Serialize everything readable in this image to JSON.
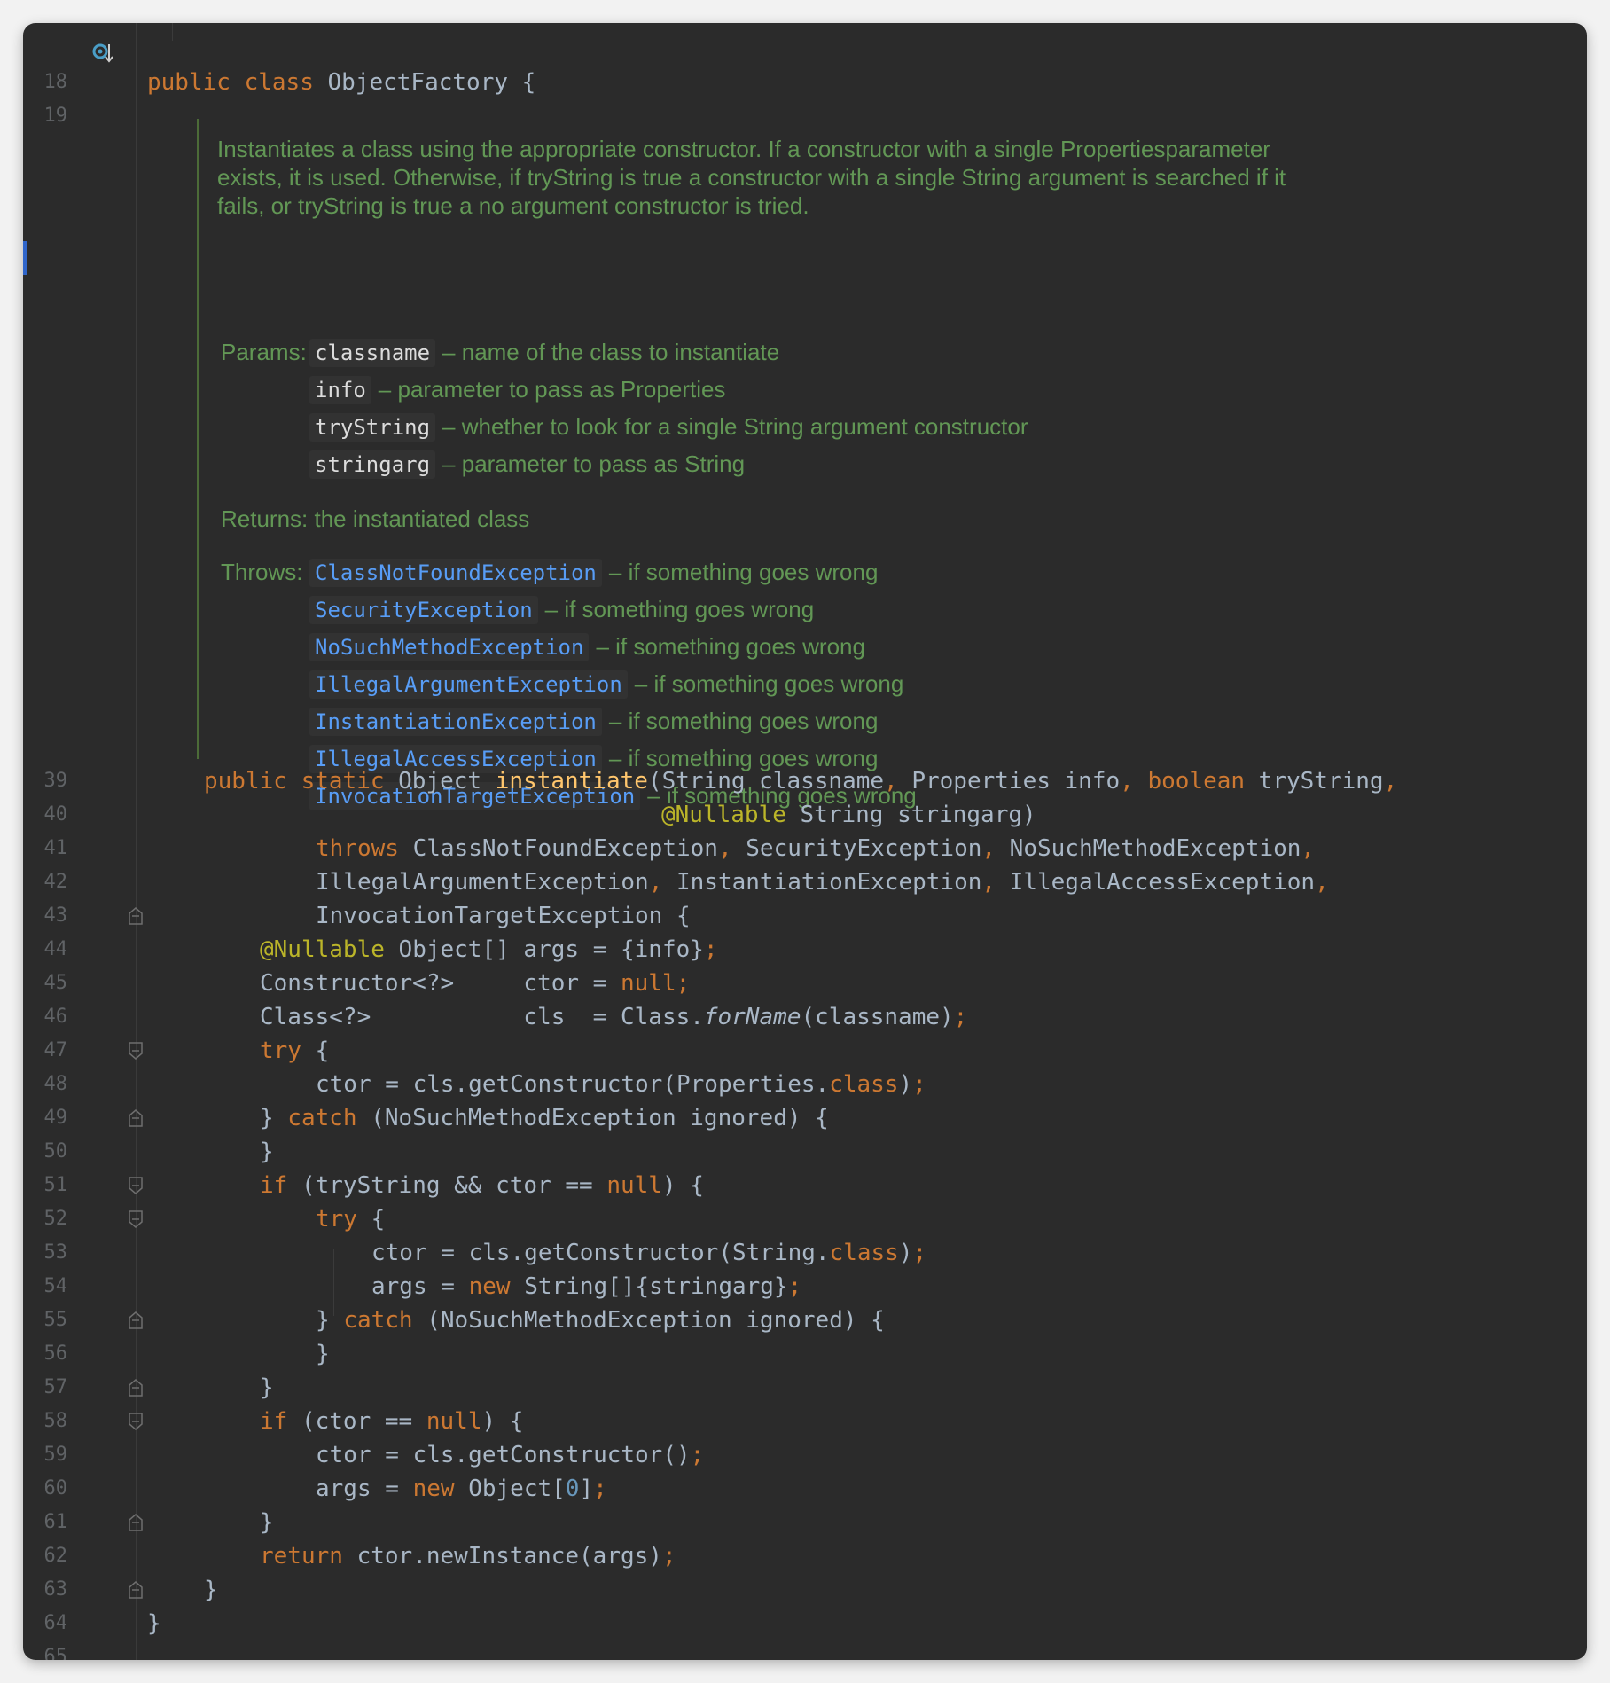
{
  "editor": {
    "lines": [
      {
        "num": "18",
        "text": "public class ObjectFactory {"
      },
      {
        "num": "19",
        "text": ""
      },
      {
        "num": "39",
        "text": "public static Object instantiate(String classname, Properties info, boolean tryString,"
      },
      {
        "num": "40",
        "text": "@Nullable String stringarg)"
      },
      {
        "num": "41",
        "text": "throws ClassNotFoundException, SecurityException, NoSuchMethodException,"
      },
      {
        "num": "42",
        "text": "IllegalArgumentException, InstantiationException, IllegalAccessException,"
      },
      {
        "num": "43",
        "text": "InvocationTargetException {"
      },
      {
        "num": "44",
        "text": "@Nullable Object[] args = {info};"
      },
      {
        "num": "45",
        "text": "Constructor<?>     ctor = null;"
      },
      {
        "num": "46",
        "text": "Class<?>           cls  = Class.forName(classname);"
      },
      {
        "num": "47",
        "text": "try {"
      },
      {
        "num": "48",
        "text": "ctor = cls.getConstructor(Properties.class);"
      },
      {
        "num": "49",
        "text": "} catch (NoSuchMethodException ignored) {"
      },
      {
        "num": "50",
        "text": "}"
      },
      {
        "num": "51",
        "text": "if (tryString && ctor == null) {"
      },
      {
        "num": "52",
        "text": "try {"
      },
      {
        "num": "53",
        "text": "ctor = cls.getConstructor(String.class);"
      },
      {
        "num": "54",
        "text": "args = new String[]{stringarg};"
      },
      {
        "num": "55",
        "text": "} catch (NoSuchMethodException ignored) {"
      },
      {
        "num": "56",
        "text": "}"
      },
      {
        "num": "57",
        "text": "}"
      },
      {
        "num": "58",
        "text": "if (ctor == null) {"
      },
      {
        "num": "59",
        "text": "ctor = cls.getConstructor();"
      },
      {
        "num": "60",
        "text": "args = new Object[0];"
      },
      {
        "num": "61",
        "text": "}"
      },
      {
        "num": "62",
        "text": "return ctor.newInstance(args);"
      },
      {
        "num": "63",
        "text": "}"
      },
      {
        "num": "64",
        "text": "}"
      },
      {
        "num": "65",
        "text": ""
      }
    ]
  },
  "doc": {
    "description": "Instantiates a class using the appropriate constructor. If a constructor with a single Propertiesparameter exists, it is used. Otherwise, if tryString is true a constructor with a single String argument is searched if it fails, or tryString is true a no argument constructor is tried.",
    "params_label": "Params:",
    "params": [
      {
        "name": "classname",
        "desc": "– name of the class to instantiate"
      },
      {
        "name": "info",
        "desc": "– parameter to pass as Properties"
      },
      {
        "name": "tryString",
        "desc": "– whether to look for a single String argument constructor"
      },
      {
        "name": "stringarg",
        "desc": "– parameter to pass as String"
      }
    ],
    "returns_label": "Returns:",
    "returns": "the instantiated class",
    "throws_label": "Throws:",
    "throws": [
      {
        "name": "ClassNotFoundException",
        "desc": "– if something goes wrong"
      },
      {
        "name": "SecurityException",
        "desc": "– if something goes wrong"
      },
      {
        "name": "NoSuchMethodException",
        "desc": "– if something goes wrong"
      },
      {
        "name": "IllegalArgumentException",
        "desc": "– if something goes wrong"
      },
      {
        "name": "InstantiationException",
        "desc": "– if something goes wrong"
      },
      {
        "name": "IllegalAccessException",
        "desc": "– if something goes wrong"
      },
      {
        "name": "InvocationTargetException",
        "desc": "– if something goes wrong"
      }
    ]
  },
  "colors": {
    "background": "#2b2b2b",
    "keyword": "#cc7832",
    "function": "#ffc66d",
    "annotation": "#bbb529",
    "number": "#6897bb",
    "doc_text": "#629755",
    "link": "#589df6",
    "plain": "#a9b7c6",
    "line_number": "#606366"
  },
  "icons": {
    "line18": "implementation-marker-icon",
    "fold": "fold-marker-icon"
  }
}
